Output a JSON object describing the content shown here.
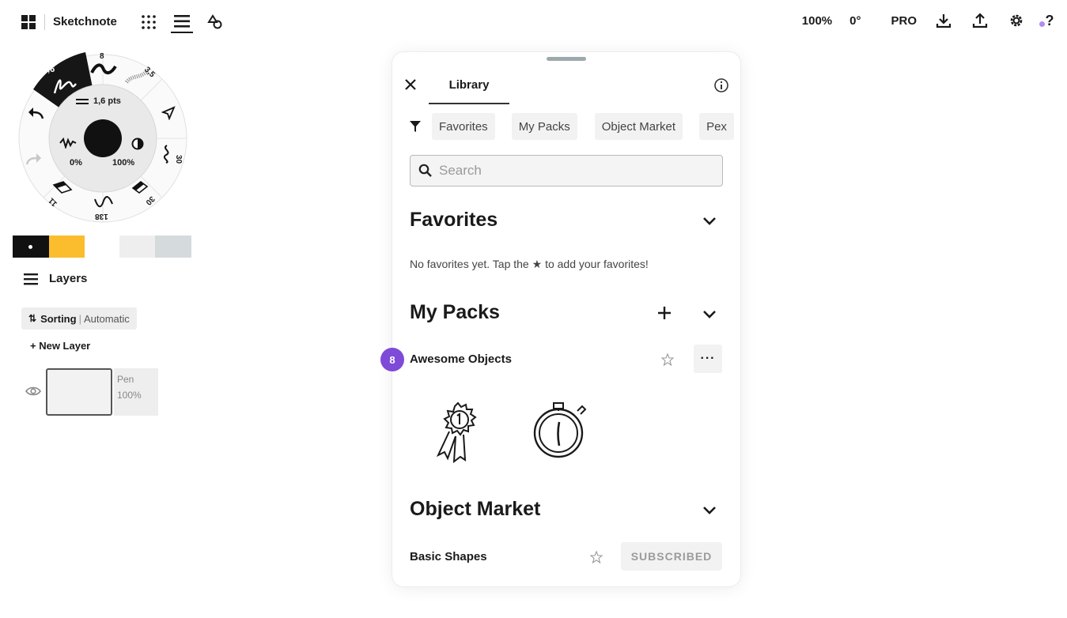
{
  "toolbar_left": {
    "document_title": "Sketchnote",
    "icons": [
      "gallery-icon",
      "grid-icon",
      "layers-menu-icon",
      "shapes-icon"
    ]
  },
  "toolbar_right": {
    "zoom": "100%",
    "rotation": "0°",
    "pro": "PRO",
    "help": "?"
  },
  "tool_wheel": {
    "brush_size_label": "1,6 pts",
    "opacity_min": "0%",
    "opacity_max": "100%",
    "tool_sizes": [
      "1,6",
      "8",
      "3,5",
      "30",
      "30",
      "138",
      "11"
    ]
  },
  "colors": {
    "swatches": [
      "#111111",
      "#fbbd2e",
      "#eeeeee",
      "#d5dadd"
    ],
    "accent": "#7e4ad8"
  },
  "layers": {
    "title": "Layers",
    "sorting_label": "Sorting",
    "sorting_mode": "Automatic",
    "new_layer": "+ New Layer",
    "items": [
      {
        "name": "Pen",
        "opacity": "100%"
      }
    ]
  },
  "library": {
    "tab": "Library",
    "filters": [
      "Favorites",
      "My Packs",
      "Object Market",
      "Pex"
    ],
    "search_placeholder": "Search",
    "favorites_title": "Favorites",
    "favorites_empty_pre": "No favorites yet. Tap the",
    "favorites_empty_post": "to add your favorites!",
    "mypacks_title": "My Packs",
    "pack_name": "Awesome Objects",
    "pack_badge": "8",
    "pack_more": "···",
    "pack_items": [
      "ribbon-medal-sketch",
      "stopwatch-sketch"
    ],
    "market_title": "Object Market",
    "market_item": "Basic Shapes",
    "market_status": "SUBSCRIBED"
  }
}
